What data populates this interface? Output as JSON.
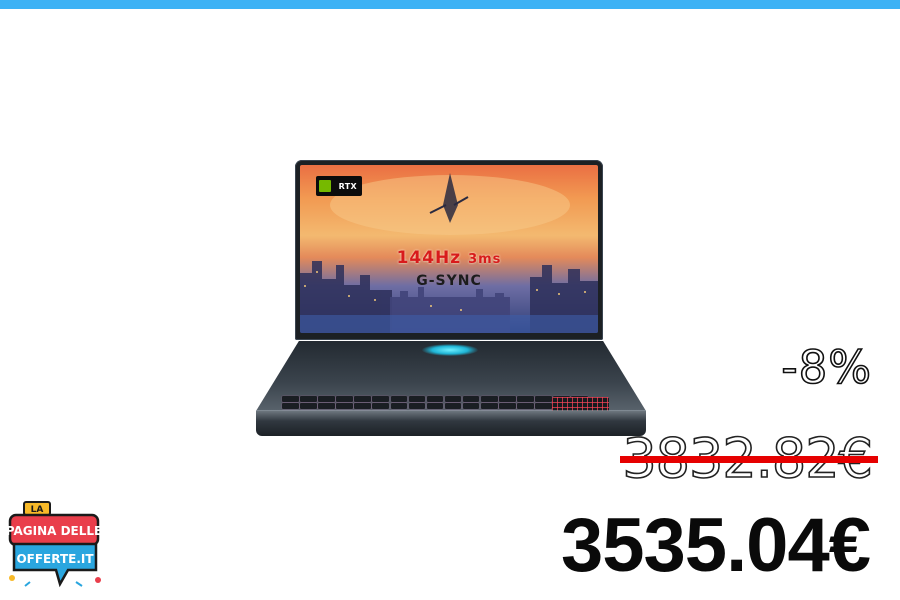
{
  "product": {
    "name": "Laptop",
    "screen": {
      "badge_text": "RTX",
      "refresh": "144Hz",
      "response": "3ms",
      "sync": "G-SYNC"
    }
  },
  "pricing": {
    "discount": "-8%",
    "old_price": "3832.82€",
    "new_price": "3535.04€"
  },
  "logo": {
    "line1": "LA",
    "line2": "PAGINA DELLE",
    "line3": "OFFERTE.IT"
  },
  "colors": {
    "top_bar": "#3db2f5",
    "strike": "#e60000",
    "logo_red": "#e93e4b",
    "logo_blue": "#2aa6df",
    "logo_yellow": "#f7b928"
  }
}
